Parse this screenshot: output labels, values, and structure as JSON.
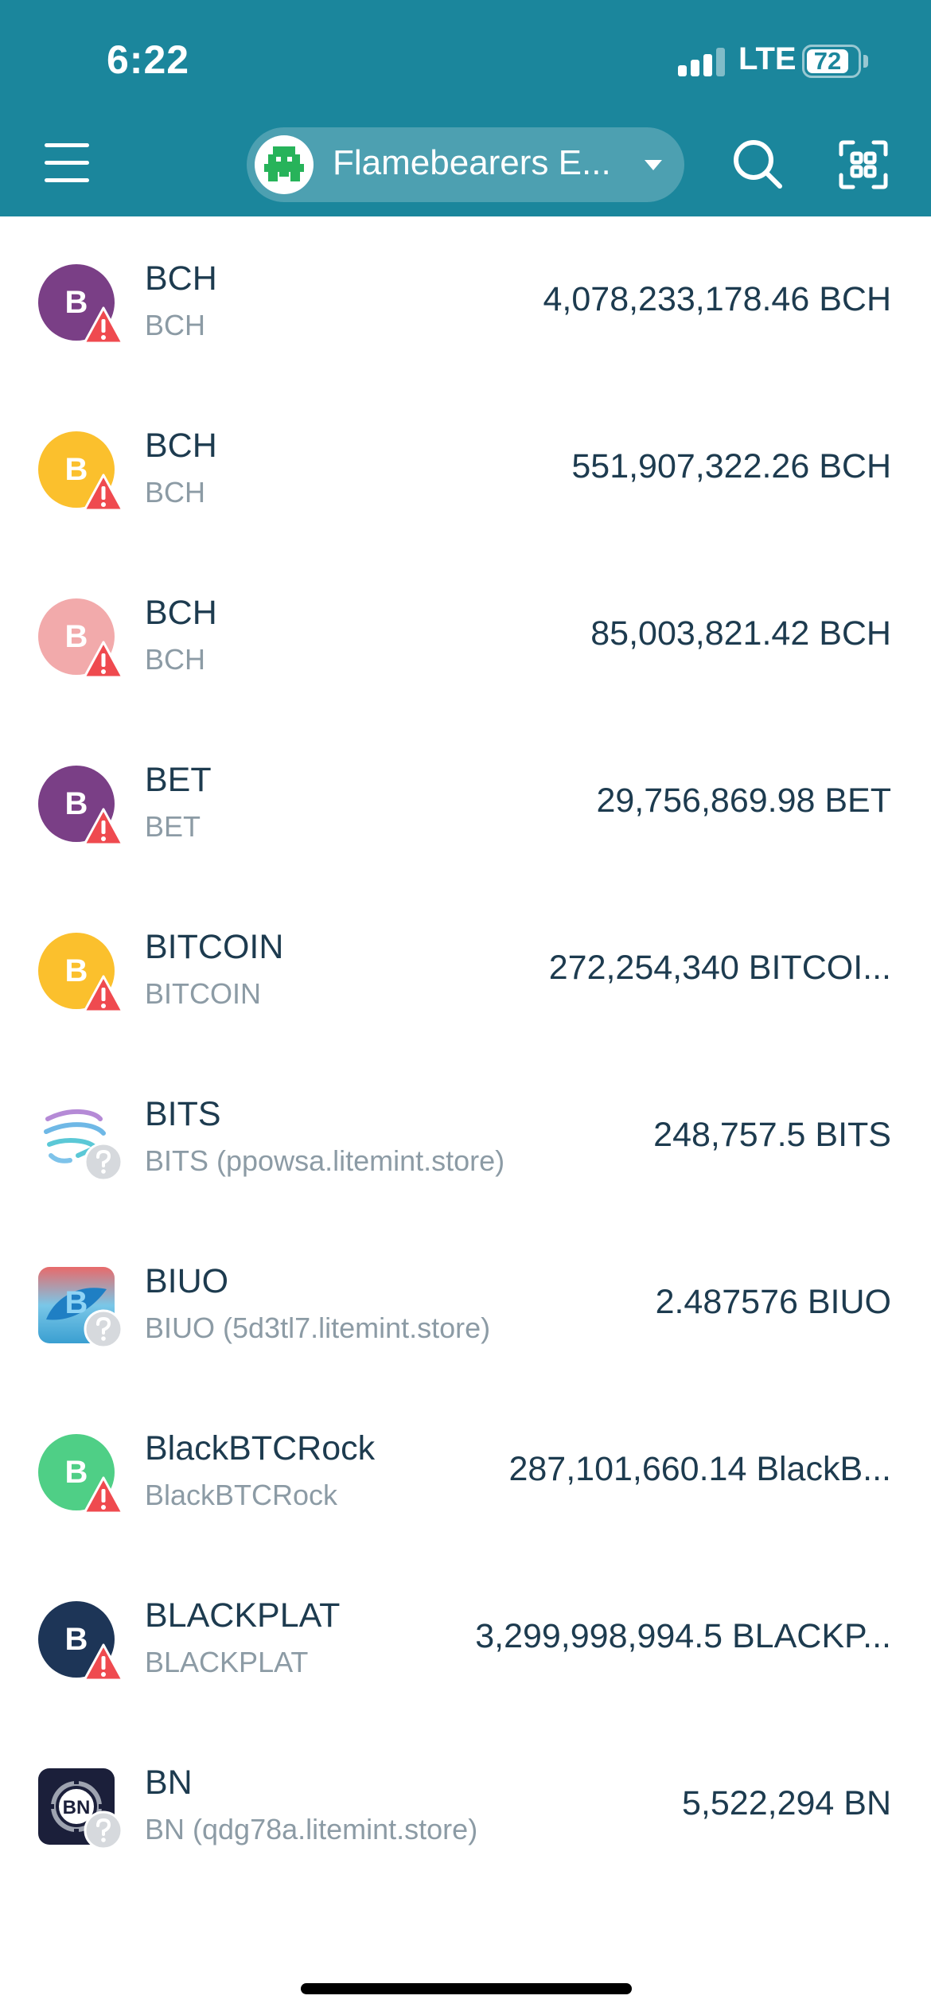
{
  "status_bar": {
    "time": "6:22",
    "network": "LTE",
    "battery": "72"
  },
  "header": {
    "account_name": "Flamebearers E..."
  },
  "colors": {
    "header_bg": "#1b869c",
    "warning": "#ef4a4f",
    "unknown_badge": "#d6d9dd"
  },
  "tokens": [
    {
      "name": "BCH",
      "subtitle": "BCH",
      "balance": "4,078,233,178.46 BCH",
      "icon_letter": "B",
      "icon_color": "#7a3f86",
      "badge": "warning-icon"
    },
    {
      "name": "BCH",
      "subtitle": "BCH",
      "balance": "551,907,322.26 BCH",
      "icon_letter": "B",
      "icon_color": "#fbc02d",
      "badge": "warning-icon"
    },
    {
      "name": "BCH",
      "subtitle": "BCH",
      "balance": "85,003,821.42 BCH",
      "icon_letter": "B",
      "icon_color": "#f2aaab",
      "badge": "warning-icon"
    },
    {
      "name": "BET",
      "subtitle": "BET",
      "balance": "29,756,869.98 BET",
      "icon_letter": "B",
      "icon_color": "#7a3f86",
      "badge": "warning-icon"
    },
    {
      "name": "BITCOIN",
      "subtitle": "BITCOIN",
      "balance": "272,254,340 BITCOI...",
      "icon_letter": "B",
      "icon_color": "#fbc02d",
      "badge": "warning-icon"
    },
    {
      "name": "BITS",
      "subtitle": "BITS (ppowsa.litemint.store)",
      "balance": "248,757.5 BITS",
      "icon": "bits-logo-icon",
      "badge": "question-icon"
    },
    {
      "name": "BIUO",
      "subtitle": "BIUO (5d3tl7.litemint.store)",
      "balance": "2.487576 BIUO",
      "icon": "biuo-logo-icon",
      "badge": "question-icon"
    },
    {
      "name": "BlackBTCRock",
      "subtitle": "BlackBTCRock",
      "balance": "287,101,660.14 BlackB...",
      "icon_letter": "B",
      "icon_color": "#4fcf86",
      "badge": "warning-icon"
    },
    {
      "name": "BLACKPLAT",
      "subtitle": "BLACKPLAT",
      "balance": "3,299,998,994.5 BLACKP...",
      "icon_letter": "B",
      "icon_color": "#1d3557",
      "badge": "warning-icon"
    },
    {
      "name": "BN",
      "subtitle": "BN (qdg78a.litemint.store)",
      "balance": "5,522,294 BN",
      "icon": "bn-logo-icon",
      "badge": "question-icon"
    }
  ]
}
